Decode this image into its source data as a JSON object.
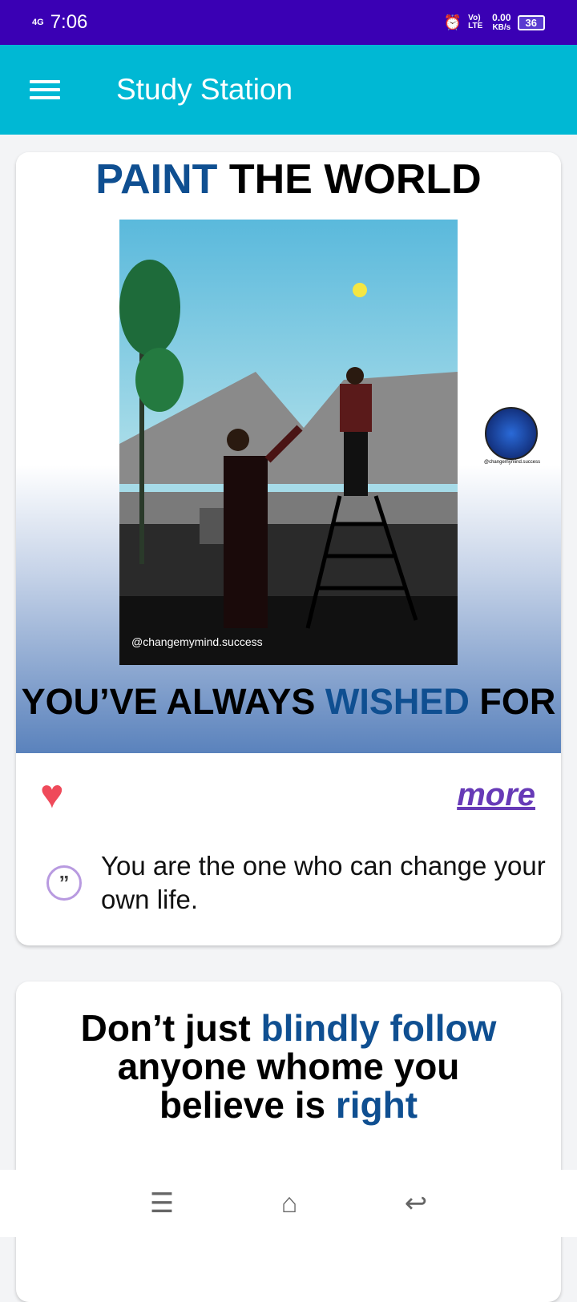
{
  "status_bar": {
    "network": "4G",
    "time": "7:06",
    "volte": "Vo) LTE",
    "speed": "0.00",
    "speed_unit": "KB/s",
    "battery": "36"
  },
  "app_bar": {
    "title": "Study Station"
  },
  "posts": [
    {
      "title_part1": "PAINT",
      "title_part2": " THE WORLD",
      "image_watermark": "@changemymind.success",
      "logo_text": "@changemymind.success",
      "caption_part1": "YOU’VE ALWAYS ",
      "caption_part2": "WISHED",
      "caption_part3": " FOR",
      "more_label": "more",
      "quote": "You are the one who can change your own life."
    },
    {
      "line1a": "Don’t just ",
      "line1b": "blindly follow",
      "line2": "anyone whome you",
      "line3a": "believe is ",
      "line3b": "right"
    }
  ],
  "colors": {
    "status_bar": "#3a00b4",
    "app_bar": "#00b8d4",
    "heart": "#ef4a5a",
    "more": "#673ab7",
    "accent_blue": "#0f4f91"
  },
  "nav": {
    "icons": [
      "menu-icon",
      "home-icon",
      "back-icon"
    ]
  }
}
